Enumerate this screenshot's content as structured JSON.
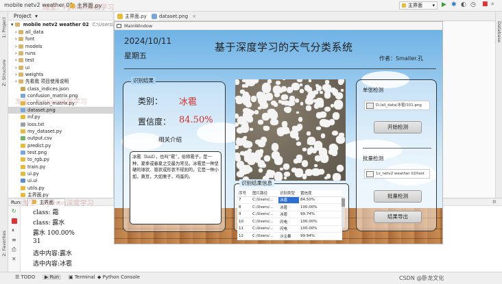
{
  "ide": {
    "project_name": "mobile netv2 weather 02",
    "current_file": "主界面.py",
    "run_config": "主界面",
    "project_panel_title": "Project",
    "project_root": "mobile netv2 weather 02",
    "project_root_path": "C:\\Users\\long\\",
    "tree": [
      {
        "label": "all_data",
        "kind": "folder"
      },
      {
        "label": "font",
        "kind": "folder"
      },
      {
        "label": "models",
        "kind": "folder"
      },
      {
        "label": "runs",
        "kind": "folder"
      },
      {
        "label": "test",
        "kind": "folder"
      },
      {
        "label": "ui",
        "kind": "folder"
      },
      {
        "label": "weights",
        "kind": "folder"
      },
      {
        "label": "先看我 项目使用说明",
        "kind": "folder"
      },
      {
        "label": "class_indices.json",
        "kind": "json"
      },
      {
        "label": "confusion_matrix.png",
        "kind": "png"
      },
      {
        "label": "confusion_matrix.py",
        "kind": "py"
      },
      {
        "label": "dataset.png",
        "kind": "png",
        "selected": true
      },
      {
        "label": "inf.py",
        "kind": "py"
      },
      {
        "label": "loss.txt",
        "kind": "txt"
      },
      {
        "label": "my_dataset.py",
        "kind": "py"
      },
      {
        "label": "output.csv",
        "kind": "csv"
      },
      {
        "label": "predict.py",
        "kind": "py"
      },
      {
        "label": "test.png",
        "kind": "png"
      },
      {
        "label": "to_rgb.py",
        "kind": "py"
      },
      {
        "label": "train.py",
        "kind": "py"
      },
      {
        "label": "ui.py",
        "kind": "py"
      },
      {
        "label": "ui.ui",
        "kind": "ui"
      },
      {
        "label": "utils.py",
        "kind": "py"
      },
      {
        "label": "主界面.py",
        "kind": "py"
      }
    ],
    "editor_tabs": [
      "主界面.py",
      "dataset.png"
    ],
    "run_tab_label": "Run:",
    "run_tab_name": "主界面",
    "output_lines": [
      "class: 霜",
      "class: 露水",
      "露水 100.00%",
      "31",
      "选中内容:露水",
      "选中内容:冰雹"
    ],
    "bottom_tabs": [
      "TODO",
      "Run",
      "Terminal",
      "Python Console"
    ],
    "left_strip_labels": [
      "1: Project",
      "Z: Structure",
      "2: Favorites"
    ],
    "right_strip_label": "Database",
    "watermark": "淘宝：Python深度学习",
    "csdn_watermark": "CSDN @卧龙文化"
  },
  "app": {
    "window_title": "MainWindow",
    "date": "2024/10/11",
    "weekday": "星期五",
    "main_title": "基于深度学习的天气分类系统",
    "author": "作者：Smaller.孔",
    "result_panel_title": "识别结果",
    "class_label": "类别：",
    "class_value": "冰雹",
    "conf_label": "置信度：",
    "conf_value": "84.50%",
    "intro_title": "相关介绍",
    "intro_text": "冰雹（hail），也叫“雹”，俗称雹子，是一种，夏季或春夏之交最为常见。冰雹是一种坚硬的球状、锥状或形状不规则的，它是一种小如，黄豆，大如栗子，鸡蛋的。",
    "single_title": "单张检测",
    "single_path": "D:/all_data/冰雹/101.png",
    "start_button": "开始检测",
    "batch_title": "批量检测",
    "batch_path": "1v_netv2 weather 02/test",
    "batch_button": "批量检测",
    "export_button": "结果导出",
    "table_title": "识别结果信息",
    "table_headers": [
      "序号",
      "图片路径",
      "识别类型",
      "置信度"
    ],
    "table_rows": [
      [
        "7",
        "C:/Users/...",
        "冰雹",
        "84.50%"
      ],
      [
        "8",
        "C:/Users/...",
        "冰雹",
        "100.00%"
      ],
      [
        "9",
        "C:/Users/...",
        "冰雹",
        "99.74%"
      ],
      [
        "10",
        "C:/Users/...",
        "闪电",
        "100.00%"
      ],
      [
        "11",
        "C:/Users/...",
        "闪电",
        "100.00%"
      ],
      [
        "12",
        "C:/Users/...",
        "沙尘暴",
        "99.94%"
      ]
    ],
    "highlight_row": 0
  },
  "colors": {
    "accent_red": "#d42a2a",
    "selection_blue": "#2d6fd1",
    "sky_top": "#6fb3e6",
    "wood": "#c98b52"
  }
}
